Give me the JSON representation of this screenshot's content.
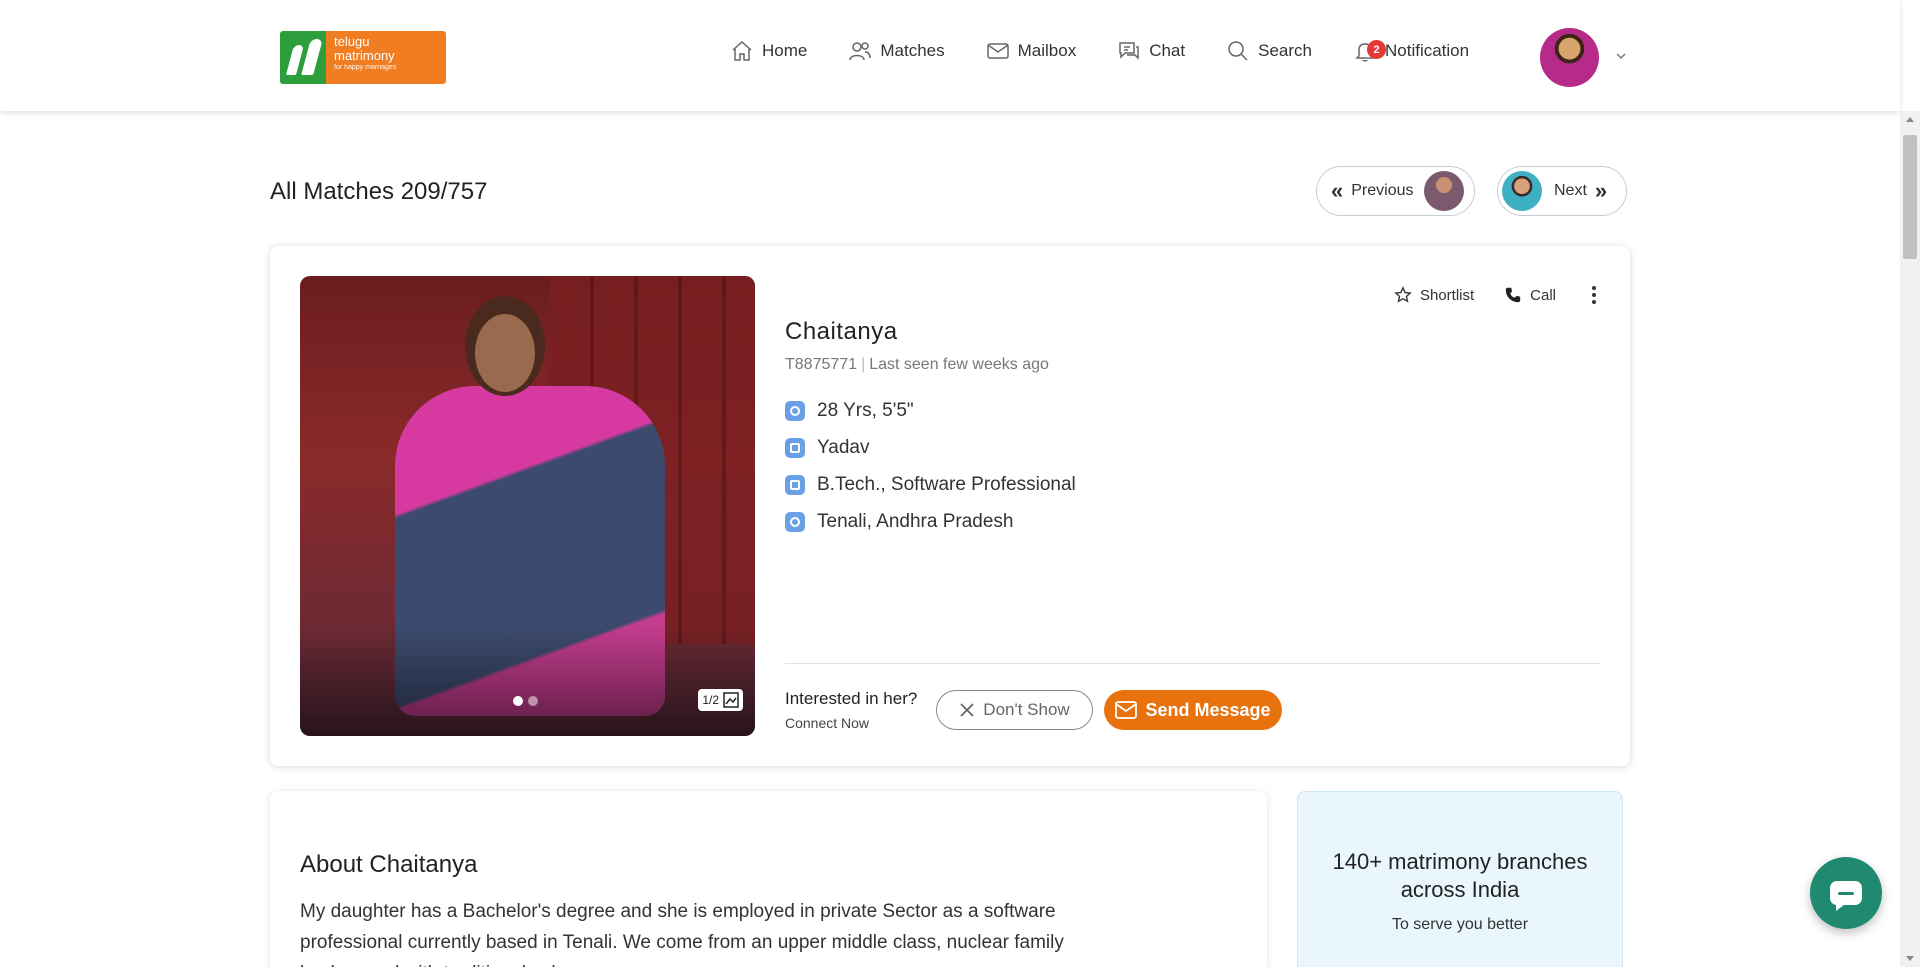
{
  "header": {
    "logo": {
      "line1": "telugu",
      "line2": "matrimony",
      "tagline": "for happy marriages"
    },
    "nav": [
      {
        "label": "Home",
        "icon": "home-icon"
      },
      {
        "label": "Matches",
        "icon": "users-icon"
      },
      {
        "label": "Mailbox",
        "icon": "mail-icon"
      },
      {
        "label": "Chat",
        "icon": "chat-icon"
      },
      {
        "label": "Search",
        "icon": "search-icon"
      },
      {
        "label": "Notification",
        "icon": "bell-icon",
        "badge": "2"
      }
    ]
  },
  "page": {
    "title": "All Matches 209/757",
    "prev_label": "Previous",
    "next_label": "Next"
  },
  "profile": {
    "name": "Chaitanya",
    "id": "T8875771",
    "last_seen": "Last seen few weeks ago",
    "age_height": "28 Yrs, 5'5\"",
    "caste": "Yadav",
    "education_job": "B.Tech., Software Professional",
    "location": "Tenali, Andhra Pradesh",
    "photo_counter": "1/2",
    "shortlist_label": "Shortlist",
    "call_label": "Call",
    "interest_question": "Interested in her?",
    "interest_sub": "Connect Now",
    "dont_show_label": "Don't Show",
    "send_message_label": "Send Message"
  },
  "about": {
    "title": "About Chaitanya",
    "text": "My daughter has a Bachelor's degree and she is employed in private Sector as a software professional currently based in Tenali. We come from an upper middle class, nuclear family background with traditional values."
  },
  "branches": {
    "title": "140+ matrimony branches across India",
    "subtitle": "To serve you better"
  },
  "colors": {
    "accent_orange": "#e8720d",
    "logo_green": "#2e9e3c",
    "logo_orange": "#f07d22",
    "chat_fab": "#1f8a6f",
    "badge_red": "#e53935"
  }
}
